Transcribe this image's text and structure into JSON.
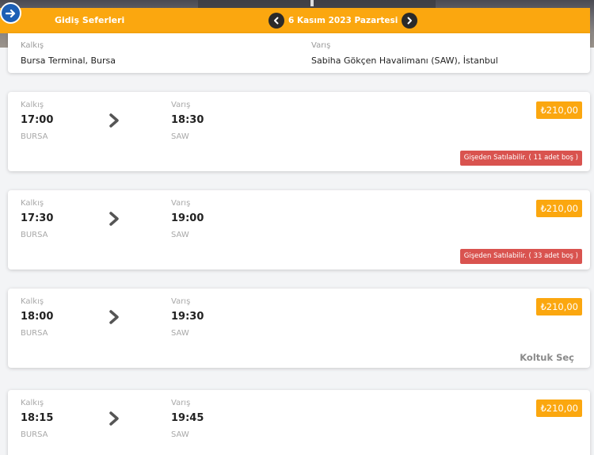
{
  "header": {
    "section_title": "Gidiş Seferleri",
    "date": "6 Kasım 2023 Pazartesi",
    "colors": {
      "accent": "#fba70f",
      "back_button": "#1d5fb5",
      "alert": "#d9534f"
    },
    "icons": {
      "back": "arrow-right-icon",
      "prev": "chevron-left-icon",
      "next": "chevron-right-icon"
    }
  },
  "route": {
    "from_label": "Kalkış",
    "from_value": "Bursa Terminal, Bursa",
    "to_label": "Varış",
    "to_value": "Sabiha Gökçen Havalimanı (SAW), İstanbul"
  },
  "trips": [
    {
      "dep_label": "Kalkış",
      "dep_time": "17:00",
      "dep_code": "BURSA",
      "arr_label": "Varış",
      "arr_time": "18:30",
      "arr_code": "SAW",
      "price": "₺210,00",
      "status": "Gişeden Satılabilir. ( 11 adet boş )"
    },
    {
      "dep_label": "Kalkış",
      "dep_time": "17:30",
      "dep_code": "BURSA",
      "arr_label": "Varış",
      "arr_time": "19:00",
      "arr_code": "SAW",
      "price": "₺210,00",
      "status": "Gişeden Satılabilir. ( 33 adet boş )"
    },
    {
      "dep_label": "Kalkış",
      "dep_time": "18:00",
      "dep_code": "BURSA",
      "arr_label": "Varış",
      "arr_time": "19:30",
      "arr_code": "SAW",
      "price": "₺210,00",
      "action": "Koltuk Seç"
    },
    {
      "dep_label": "Kalkış",
      "dep_time": "18:15",
      "dep_code": "BURSA",
      "arr_label": "Varış",
      "arr_time": "19:45",
      "arr_code": "SAW",
      "price": "₺210,00"
    }
  ]
}
